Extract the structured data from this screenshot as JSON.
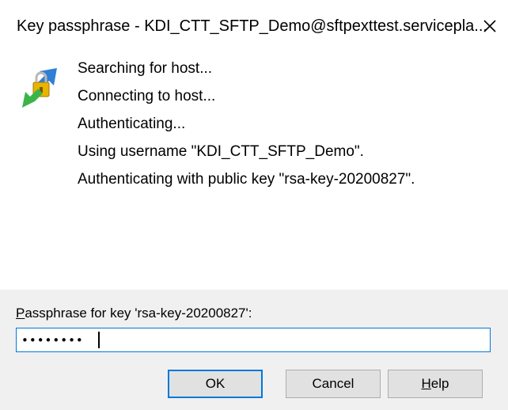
{
  "window": {
    "title": "Key passphrase - KDI_CTT_SFTP_Demo@sftpexttest.servicepla..."
  },
  "log": {
    "lines": [
      "Searching for host...",
      "Connecting to host...",
      "Authenticating...",
      "Using username \"KDI_CTT_SFTP_Demo\".",
      "Authenticating with public key \"rsa-key-20200827\"."
    ]
  },
  "passphrase": {
    "label": "Passphrase for key 'rsa-key-20200827':",
    "value": "••••••••"
  },
  "buttons": {
    "ok": "OK",
    "cancel": "Cancel",
    "help": "Help"
  },
  "icons": {
    "close": "close-icon",
    "app": "key-connection-icon"
  },
  "colors": {
    "accent": "#0078d7",
    "dialog_bg": "#f0f0f0",
    "button_bg": "#e1e1e1"
  }
}
